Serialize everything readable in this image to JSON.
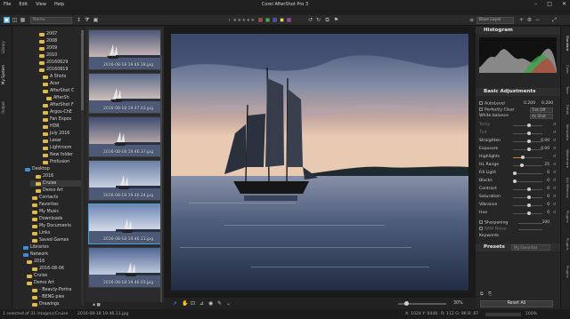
{
  "app": {
    "title": "Corel AfterShot Pro 3",
    "menu": [
      "File",
      "Edit",
      "View",
      "Help"
    ],
    "window_controls": [
      "–",
      "□",
      "✕"
    ]
  },
  "toolbar": {
    "name_filter": "Name",
    "stars": "• ★★★★★",
    "swatch_colors": [
      "#e03030",
      "#30c030",
      "#3050e0",
      "#e0e030",
      "#c030c0"
    ],
    "layer_select": "Base Layer"
  },
  "left_tabs": [
    "My System",
    "Library",
    "Output"
  ],
  "tree": {
    "items": [
      {
        "label": "2007",
        "icon": "folder"
      },
      {
        "label": "2008",
        "icon": "folder"
      },
      {
        "label": "2009",
        "icon": "folder"
      },
      {
        "label": "2010",
        "icon": "folder"
      },
      {
        "label": "20160629",
        "icon": "folder"
      },
      {
        "label": "20160819",
        "icon": "folder"
      },
      {
        "label": "A Shots",
        "icon": "folder"
      },
      {
        "label": "Acer",
        "icon": "folder"
      },
      {
        "label": "AfterShot C",
        "icon": "folder"
      },
      {
        "label": "AfterSh",
        "icon": "folder"
      },
      {
        "label": "AfterShot F",
        "icon": "folder"
      },
      {
        "label": "Argos-ChE",
        "icon": "folder"
      },
      {
        "label": "Fan Expos",
        "icon": "folder"
      },
      {
        "label": "HDR",
        "icon": "folder"
      },
      {
        "label": "July 2016",
        "icon": "folder"
      },
      {
        "label": "Lesar",
        "icon": "folder"
      },
      {
        "label": "Lightroom",
        "icon": "folder"
      },
      {
        "label": "New folder",
        "icon": "folder"
      },
      {
        "label": "Profusion",
        "icon": "folder"
      },
      {
        "label": "Desktop",
        "icon": "folder-blue"
      },
      {
        "label": "2016",
        "icon": "folder"
      },
      {
        "label": "Cruise",
        "icon": "folder"
      },
      {
        "label": "Demo Art",
        "icon": "folder"
      },
      {
        "label": "Contacts",
        "icon": "folder"
      },
      {
        "label": "Favorites",
        "icon": "folder"
      },
      {
        "label": "My Music",
        "icon": "folder"
      },
      {
        "label": "Downloads",
        "icon": "folder"
      },
      {
        "label": "My Documents",
        "icon": "folder"
      },
      {
        "label": "Links",
        "icon": "folder"
      },
      {
        "label": "Saved Games",
        "icon": "folder"
      },
      {
        "label": "Libraries",
        "icon": "folder-blue"
      },
      {
        "label": "Network",
        "icon": "folder-blue"
      },
      {
        "label": "2016",
        "icon": "folder"
      },
      {
        "label": "2016-08-06",
        "icon": "folder"
      },
      {
        "label": "Cruise",
        "icon": "folder"
      },
      {
        "label": "Demo Art",
        "icon": "folder"
      },
      {
        "label": "- Beauty-Portra",
        "icon": "folder"
      },
      {
        "label": "- BENG pies",
        "icon": "folder"
      },
      {
        "label": "Drawings",
        "icon": "folder"
      }
    ]
  },
  "thumbnails": [
    {
      "label": "2016-08-18 19.46.18.jpg"
    },
    {
      "label": "2016-08-18 19.47.03.jpg"
    },
    {
      "label": "2016-08-18 19.46.37.jpg"
    },
    {
      "label": "2016-08-18 19.46.24.jpg"
    },
    {
      "label": "2016-08-18 19.46.11.jpg"
    },
    {
      "label": "2016-08-18 19.46.03.jpg"
    }
  ],
  "viewer": {
    "zoom": "30%"
  },
  "right_panel": {
    "histogram_title": "Histogram",
    "basic_title": "Basic Adjustments",
    "autolevel": {
      "label": "AutoLevel",
      "v1": "0.200",
      "v2": "0.200"
    },
    "perfectly_clear": {
      "label": "Perfectly Clear",
      "value": "Tint Off"
    },
    "white_balance": {
      "label": "White balance",
      "value": "As Shot"
    },
    "rows": [
      {
        "label": "Temp",
        "value": "",
        "pos": 0.5
      },
      {
        "label": "Tint",
        "value": "",
        "pos": 0.5
      },
      {
        "label": "Straighten",
        "value": "0.00",
        "pos": 0.5
      },
      {
        "label": "Exposure",
        "value": "0.00",
        "pos": 0.5
      },
      {
        "label": "Highlights",
        "value": "",
        "pos": 0.3
      },
      {
        "label": "HL Range",
        "value": "25",
        "pos": 0.25
      },
      {
        "label": "Fill Light",
        "value": "0",
        "pos": 0.0
      },
      {
        "label": "Blacks",
        "value": "0",
        "pos": 0.0
      },
      {
        "label": "Contrast",
        "value": "0",
        "pos": 0.5
      },
      {
        "label": "Saturation",
        "value": "0",
        "pos": 0.5
      },
      {
        "label": "Vibrance",
        "value": "0",
        "pos": 0.5
      },
      {
        "label": "Hue",
        "value": "0",
        "pos": 0.5
      }
    ],
    "sharpening": {
      "label": "Sharpening",
      "value": "100"
    },
    "raw_noise": {
      "label": "RAW Noise",
      "value": ""
    },
    "keywords": "Keywords",
    "presets_title": "Presets",
    "presets_select": "My Favorites",
    "reset_all": "Reset All"
  },
  "right_tabs": [
    "Standard",
    "Color",
    "Tone",
    "Detail",
    "Metadata",
    "Watermark",
    "Kill Wireless",
    "Plugins",
    "Plugins",
    "Plugins"
  ],
  "statusbar": {
    "selection": "1 selected of 31 image(s)",
    "folder": "Cruise",
    "file": "2016-08-18 19.46.11.jpg",
    "coords": "X: 1024  Y: 0448",
    "rgb": "R: 112 G: 96 B: 87",
    "progress": "100%"
  }
}
